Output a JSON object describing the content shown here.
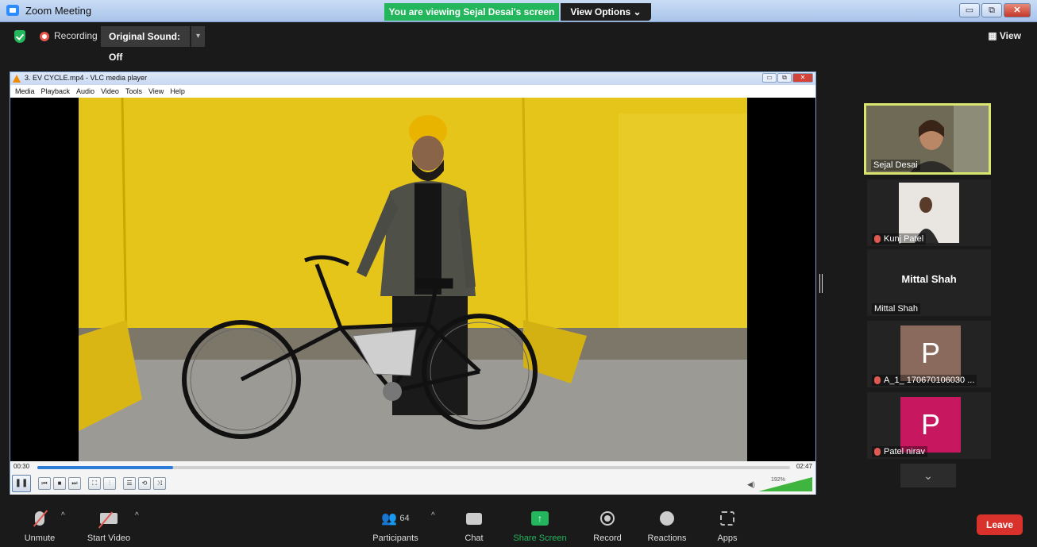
{
  "window": {
    "title": "Zoom Meeting",
    "controls": [
      "▭",
      "⧉",
      "✕"
    ]
  },
  "share_banner": {
    "text": "You are viewing Sejal Desai's screen",
    "view_options": "View Options ⌄"
  },
  "meeting_bar": {
    "recording_label": "Recording",
    "original_sound": "Original Sound: Off",
    "view_label": "View"
  },
  "vlc": {
    "title": "3. EV CYCLE.mp4 - VLC media player",
    "menu": [
      "Media",
      "Playback",
      "Audio",
      "Video",
      "Tools",
      "View",
      "Help"
    ],
    "time_elapsed": "00:30",
    "time_total": "02:47",
    "progress_fraction": 0.18,
    "volume_label": "192%"
  },
  "participants": [
    {
      "name": "Sejal Desai",
      "type": "video",
      "active": true,
      "muted": false
    },
    {
      "name": "Kunj Patel",
      "type": "video",
      "active": false,
      "muted": true
    },
    {
      "name": "Mittal Shah",
      "type": "name",
      "display": "Mittal Shah",
      "muted": false
    },
    {
      "name": "A_1_ 170670106030 ...",
      "type": "avatar",
      "initial": "P",
      "color": "#8b6a5e",
      "muted": true
    },
    {
      "name": "Patel nirav",
      "type": "avatar",
      "initial": "P",
      "color": "#c7185f",
      "muted": true
    }
  ],
  "toolbar": {
    "unmute": "Unmute",
    "start_video": "Start Video",
    "participants": "Participants",
    "participants_count": "64",
    "chat": "Chat",
    "share_screen": "Share Screen",
    "record": "Record",
    "reactions": "Reactions",
    "apps": "Apps",
    "leave": "Leave"
  },
  "colors": {
    "share_green": "#23b65c",
    "leave_red": "#d9312b",
    "active_speaker": "#d8e56e"
  }
}
